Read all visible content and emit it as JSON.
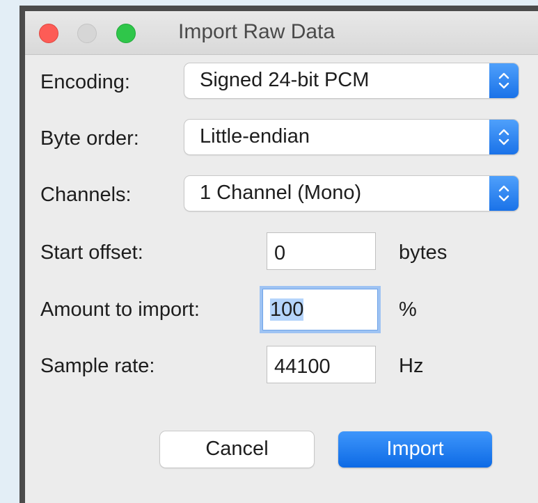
{
  "window": {
    "title": "Import Raw Data",
    "controls": [
      "close",
      "minimize",
      "maximize"
    ]
  },
  "form": {
    "encoding": {
      "label": "Encoding:",
      "value": "Signed 24-bit PCM"
    },
    "byte_order": {
      "label": "Byte order:",
      "value": "Little-endian"
    },
    "channels": {
      "label": "Channels:",
      "value": "1 Channel (Mono)"
    },
    "start_offset": {
      "label": "Start offset:",
      "value": "0",
      "unit": "bytes"
    },
    "amount": {
      "label": "Amount to import:",
      "value": "100",
      "unit": "%"
    },
    "sample_rate": {
      "label": "Sample rate:",
      "value": "44100",
      "unit": "Hz"
    }
  },
  "buttons": {
    "cancel": "Cancel",
    "import": "Import"
  },
  "icons": {
    "stepper": "chevron-up-down-icon"
  },
  "colors": {
    "accent": "#1a72e8",
    "close": "#fd5c56",
    "maximize": "#2fc64a",
    "selection": "#b5d4fb"
  }
}
